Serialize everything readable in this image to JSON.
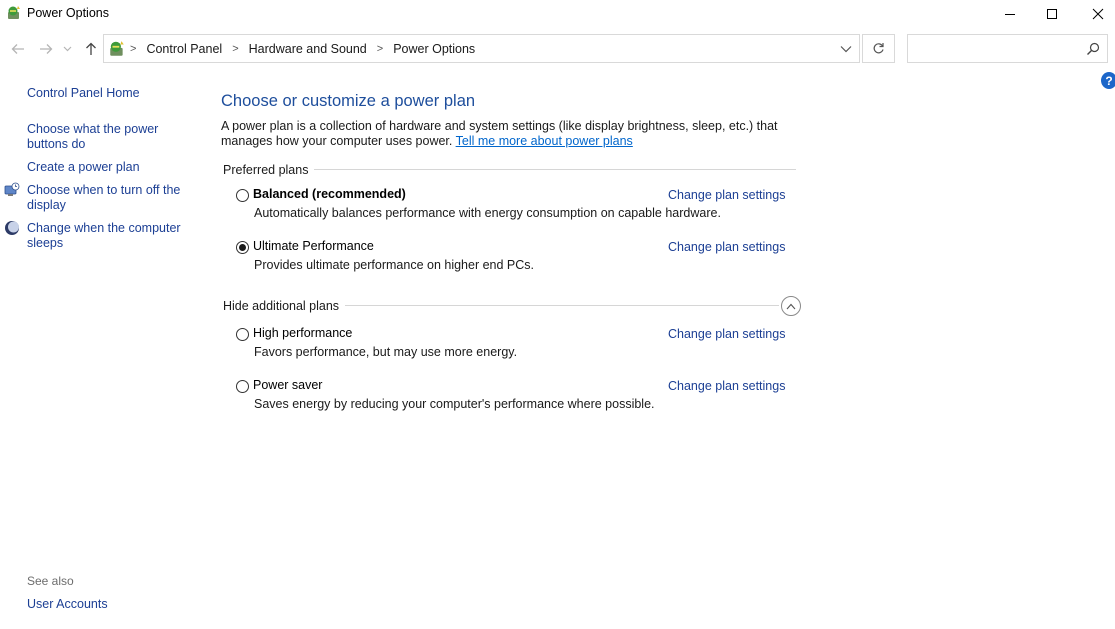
{
  "window": {
    "title": "Power Options",
    "app_icon": "power-options-icon",
    "controls": {
      "minimize": "minimize-icon",
      "maximize": "maximize-icon",
      "close": "close-icon"
    }
  },
  "navigation": {
    "back": "back-arrow-icon",
    "forward": "forward-arrow-icon",
    "recent": "chevron-down-icon",
    "up": "up-arrow-icon",
    "breadcrumbs": [
      "Control Panel",
      "Hardware and Sound",
      "Power Options"
    ],
    "refresh": "refresh-icon",
    "search": {
      "value": "",
      "placeholder": ""
    },
    "help": "?"
  },
  "sidebar": {
    "home": "Control Panel Home",
    "links": [
      {
        "label": "Choose what the power buttons do",
        "icon": null
      },
      {
        "label": "Create a power plan",
        "icon": null
      },
      {
        "label": "Choose when to turn off the display",
        "icon": "display-clock-icon"
      },
      {
        "label": "Change when the computer sleeps",
        "icon": "moon-sleep-icon"
      }
    ],
    "see_also": "See also",
    "see_also_links": [
      "User Accounts"
    ]
  },
  "main": {
    "title": "Choose or customize a power plan",
    "description": "A power plan is a collection of hardware and system settings (like display brightness, sleep, etc.) that manages how your computer uses power.",
    "learn_more_link": "Tell me more about power plans",
    "preferred_heading": "Preferred plans",
    "additional_heading": "Hide additional plans",
    "change_link_label": "Change plan settings",
    "preferred_plans": [
      {
        "name": "Balanced (recommended)",
        "description": "Automatically balances performance with energy consumption on capable hardware.",
        "selected": false,
        "bold": true
      },
      {
        "name": "Ultimate Performance",
        "description": "Provides ultimate performance on higher end PCs.",
        "selected": true,
        "bold": false
      }
    ],
    "additional_plans": [
      {
        "name": "High performance",
        "description": "Favors performance, but may use more energy.",
        "selected": false,
        "bold": false
      },
      {
        "name": "Power saver",
        "description": "Saves energy by reducing your computer's performance where possible.",
        "selected": false,
        "bold": false
      }
    ]
  },
  "colors": {
    "link": "#1c3f94",
    "title": "#1e4e9c",
    "hyperlink": "#0066cc",
    "help_badge": "#1c66c9"
  }
}
